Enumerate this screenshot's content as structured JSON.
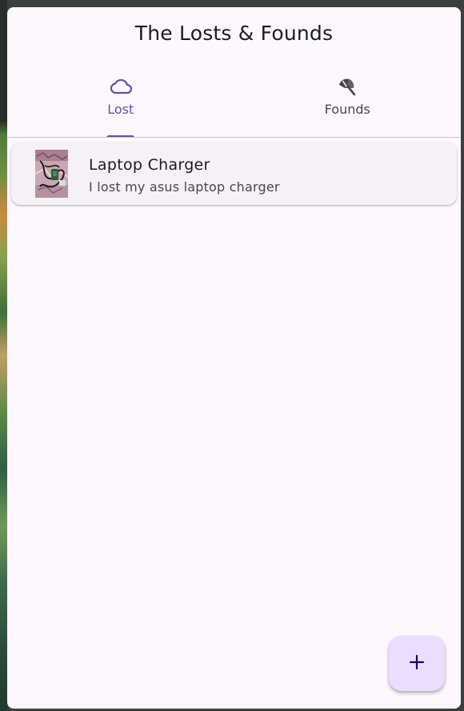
{
  "app": {
    "title": "The Losts & Founds"
  },
  "tabs": [
    {
      "label": "Lost",
      "icon": "cloud-icon",
      "active": true
    },
    {
      "label": "Founds",
      "icon": "beach-umbrella-icon",
      "active": false
    }
  ],
  "lost_items": [
    {
      "title": "Laptop Charger",
      "description": "I lost my asus laptop charger",
      "thumbnail": "charger-photo"
    }
  ],
  "fab": {
    "icon": "plus-icon"
  },
  "colors": {
    "accent": "#6750a4",
    "surface": "#fef7fe",
    "card": "#f6f1f7",
    "fab": "#eaddff",
    "on_surface": "#1d1b20",
    "on_surface_variant": "#49454f"
  }
}
